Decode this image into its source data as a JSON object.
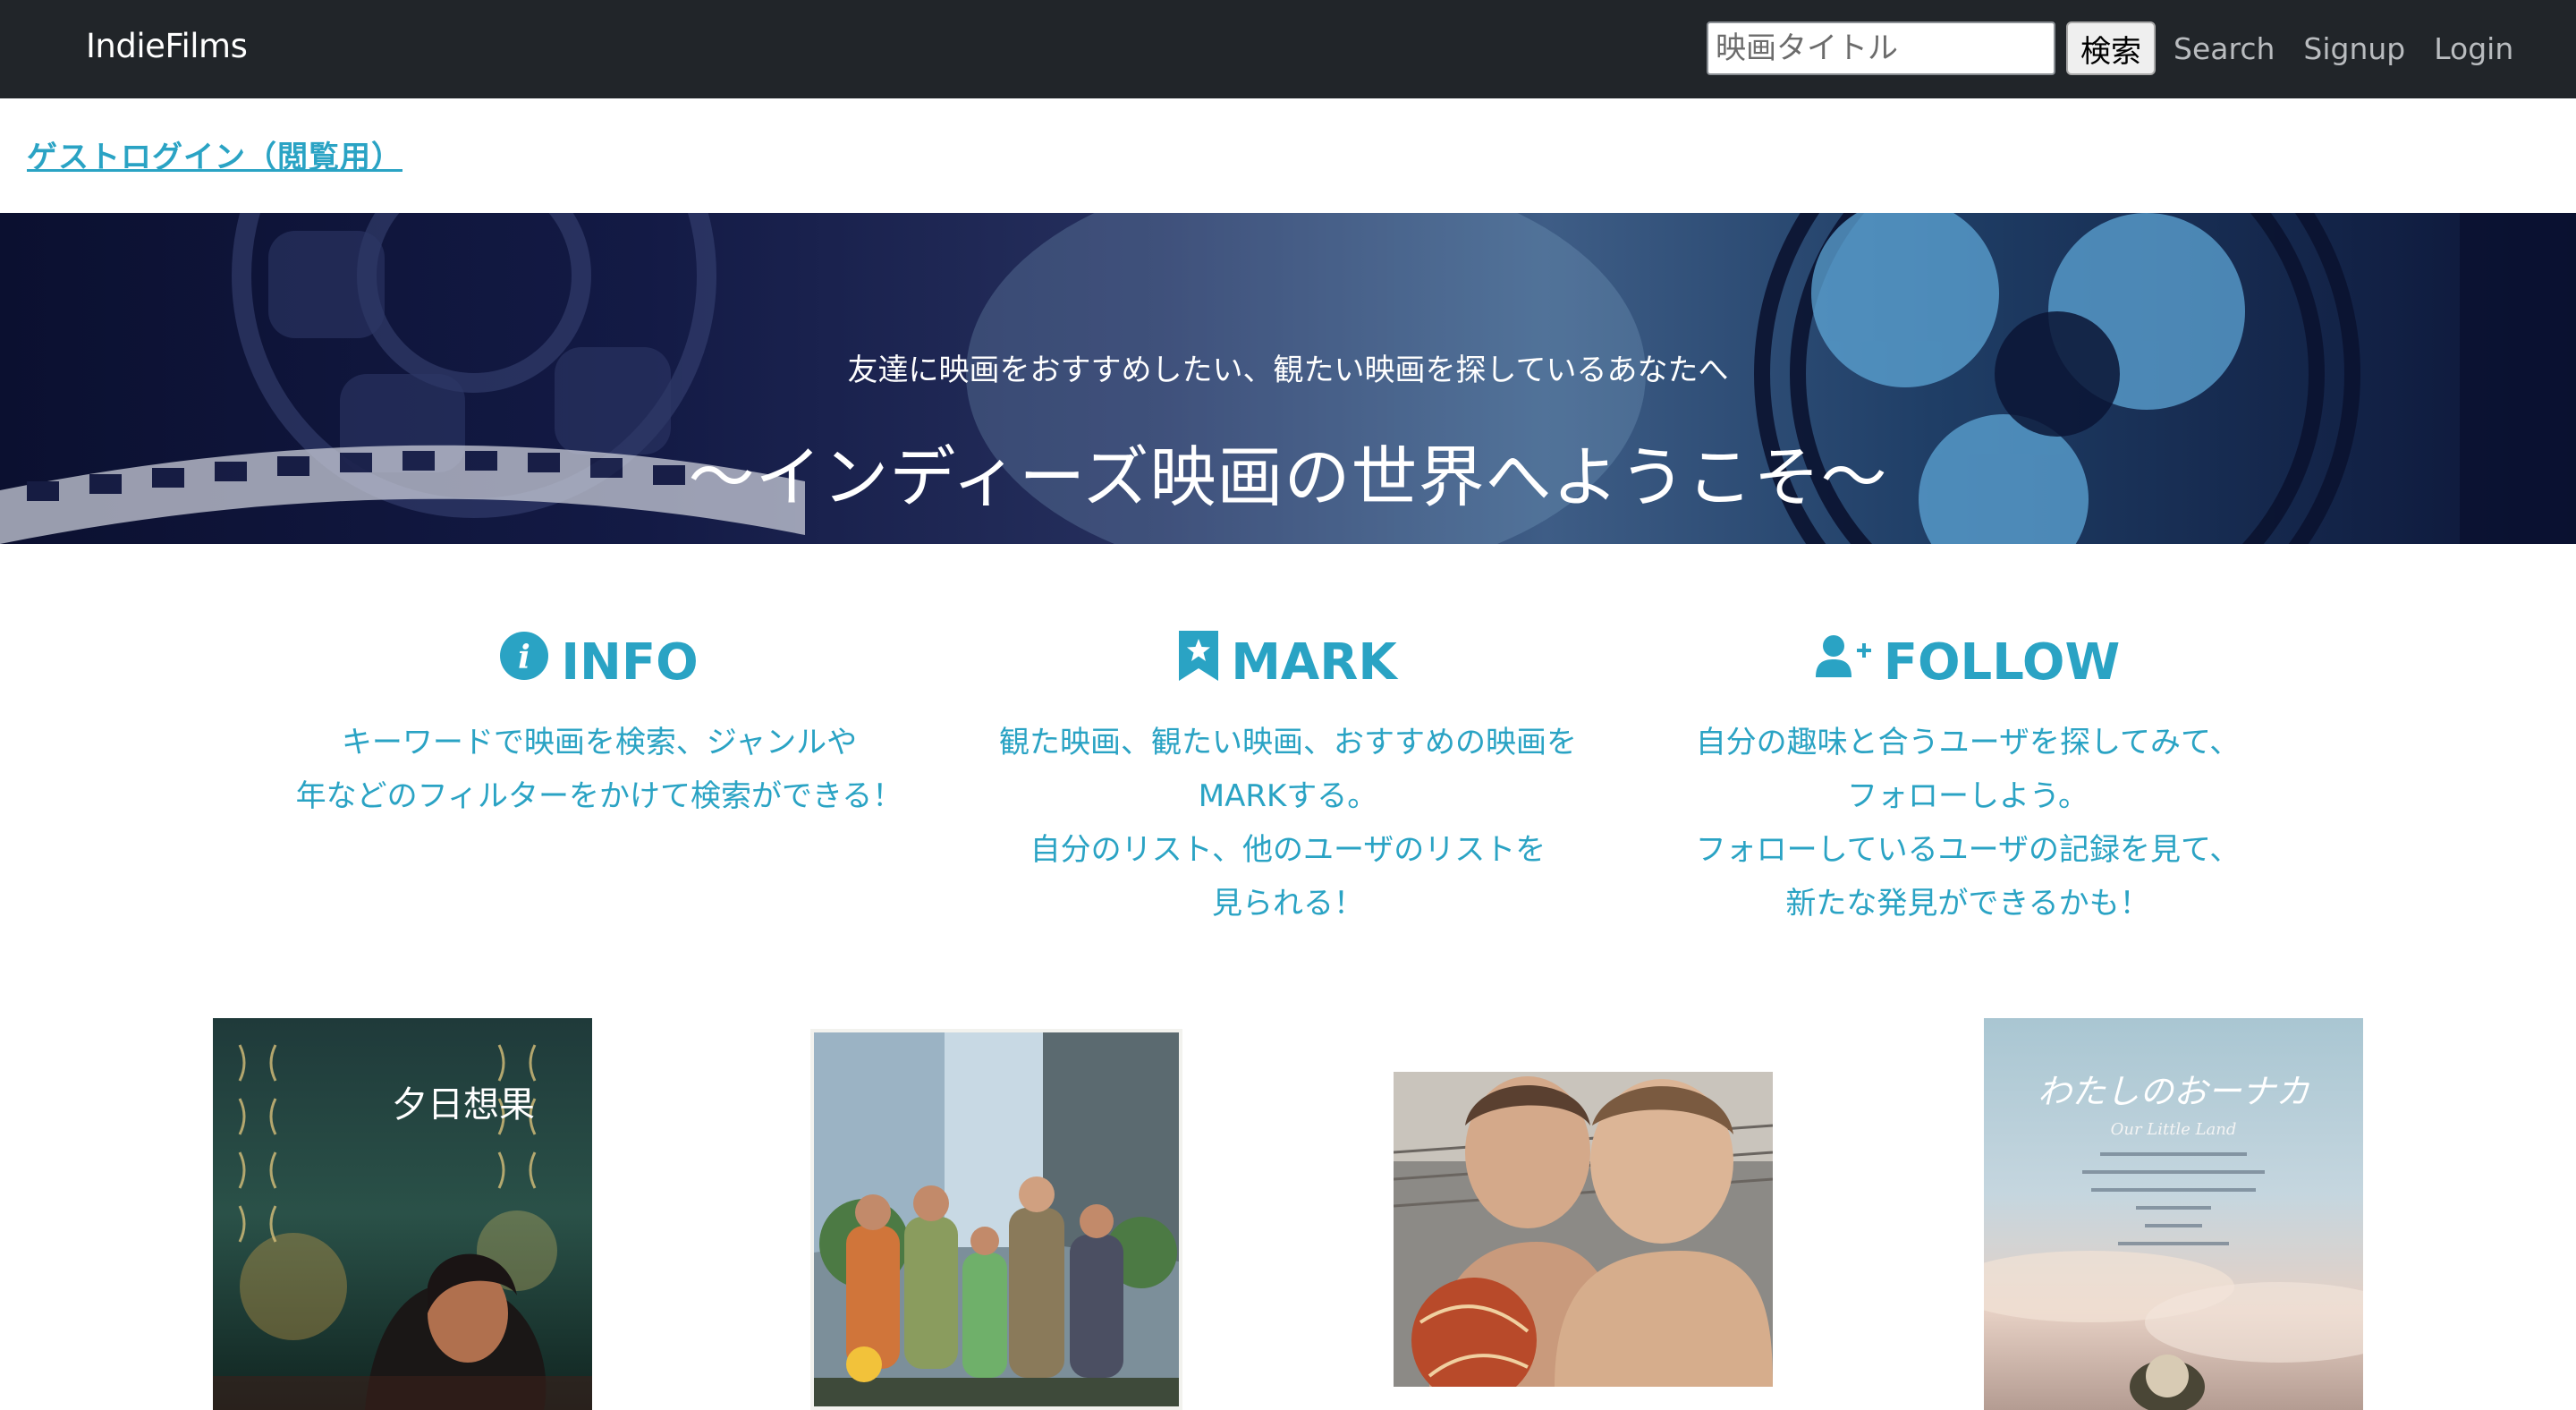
{
  "navbar": {
    "brand": "IndieFilms",
    "search_placeholder": "映画タイトル",
    "search_button": "検索",
    "links": [
      "Search",
      "Signup",
      "Login"
    ]
  },
  "guest_login": "ゲストログイン（閲覧用）",
  "hero": {
    "subtitle": "友達に映画をおすすめしたい、観たい映画を探しているあなたへ",
    "title": "〜インディーズ映画の世界へようこそ〜"
  },
  "features": [
    {
      "icon": "info-circle-icon",
      "title": "INFO",
      "lines": [
        "キーワードで映画を検索、ジャンルや",
        "年などのフィルターをかけて検索ができる！"
      ]
    },
    {
      "icon": "bookmark-star-icon",
      "title": "MARK",
      "lines": [
        "観た映画、観たい映画、おすすめの映画を",
        "MARKする。",
        "自分のリスト、他のユーザのリストを",
        "見られる！"
      ]
    },
    {
      "icon": "person-plus-icon",
      "title": "FOLLOW",
      "lines": [
        "自分の趣味と合うユーザを探してみて、",
        "フォローしよう。",
        "フォローしているユーザの記録を見て、",
        "新たな発見ができるかも！"
      ]
    }
  ],
  "posters": [
    {
      "title_text": "夕日想果"
    },
    {
      "caption": ""
    },
    {
      "caption": ""
    },
    {
      "title_text": "わたしのおーナカ",
      "subtitle_text": "Our Little Land"
    }
  ],
  "colors": {
    "navbar": "#212529",
    "accent": "#2aa3c4",
    "link_muted": "#b9bcbf"
  }
}
